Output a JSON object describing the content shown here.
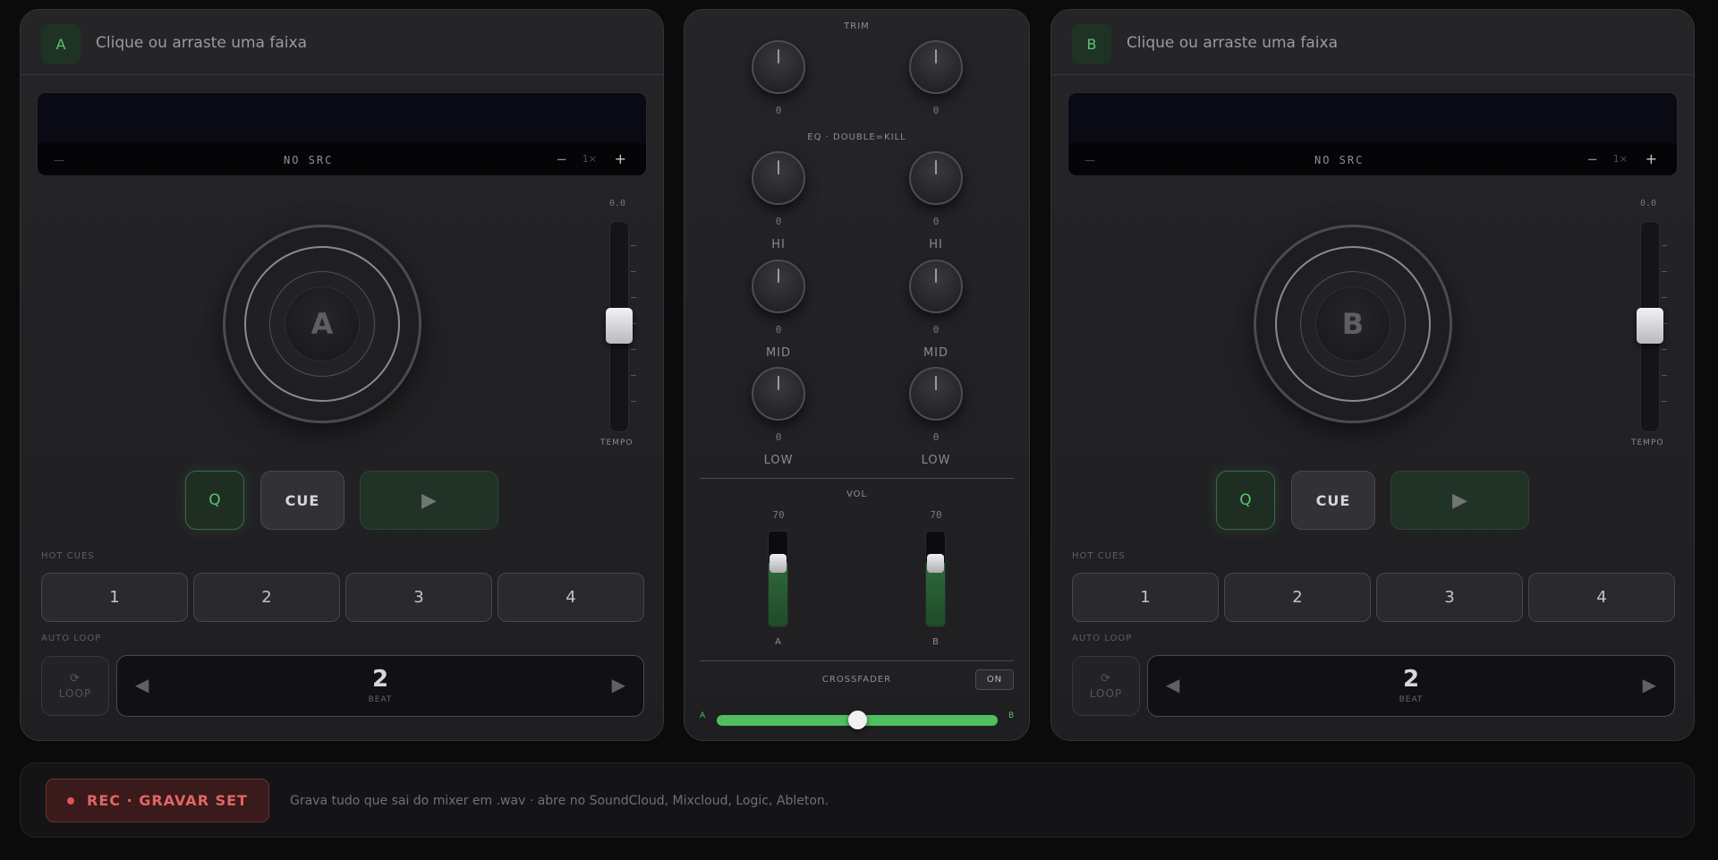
{
  "decks": [
    {
      "id": "a",
      "badge": "A",
      "hint": "Clique ou arraste uma faixa",
      "wave": {
        "dash": "—",
        "source": "NO SRC",
        "zoom_out": "−",
        "zoom": "1×",
        "zoom_in": "+"
      },
      "platter_label": "A",
      "tempo": {
        "value": "0.0",
        "label": "TEMPO"
      },
      "transport": {
        "quantize": "Q",
        "cue": "CUE",
        "play_icon": "play-icon"
      },
      "hot_cues_label": "HOT CUES",
      "hot_cues": [
        "1",
        "2",
        "3",
        "4"
      ],
      "auto_loop_label": "AUTO LOOP",
      "loop": {
        "icon": "⟳",
        "label": "LOOP",
        "prev": "◀",
        "next": "▶",
        "value": "2",
        "unit": "BEAT"
      }
    },
    {
      "id": "b",
      "badge": "B",
      "hint": "Clique ou arraste uma faixa",
      "wave": {
        "dash": "—",
        "source": "NO SRC",
        "zoom_out": "−",
        "zoom": "1×",
        "zoom_in": "+"
      },
      "platter_label": "B",
      "tempo": {
        "value": "0.0",
        "label": "TEMPO"
      },
      "transport": {
        "quantize": "Q",
        "cue": "CUE",
        "play_icon": "play-icon"
      },
      "hot_cues_label": "HOT CUES",
      "hot_cues": [
        "1",
        "2",
        "3",
        "4"
      ],
      "auto_loop_label": "AUTO LOOP",
      "loop": {
        "icon": "⟳",
        "label": "LOOP",
        "prev": "◀",
        "next": "▶",
        "value": "2",
        "unit": "BEAT"
      }
    }
  ],
  "mixer": {
    "trim_label": "TRIM",
    "trim": [
      "0",
      "0"
    ],
    "eq_label": "EQ · DOUBLE=KILL",
    "eq_bands": [
      {
        "label": "HI",
        "values": [
          "0",
          "0"
        ]
      },
      {
        "label": "MID",
        "values": [
          "0",
          "0"
        ]
      },
      {
        "label": "LOW",
        "values": [
          "0",
          "0"
        ]
      }
    ],
    "vol_label": "VOL",
    "vol": [
      {
        "value": "70",
        "level": 70,
        "channel": "A"
      },
      {
        "value": "70",
        "level": 70,
        "channel": "B"
      }
    ],
    "crossfader_label": "CROSSFADER",
    "crossfader_toggle": "ON",
    "crossfader_position": 0.5,
    "crossfader_left": "A",
    "crossfader_right": "B",
    "accent": "#4fbf62"
  },
  "record": {
    "button_label": "REC · GRAVAR SET",
    "description": "Grava tudo que sai do mixer em .wav · abre no SoundCloud, Mixcloud, Logic, Ableton.",
    "color": "#e26565"
  }
}
